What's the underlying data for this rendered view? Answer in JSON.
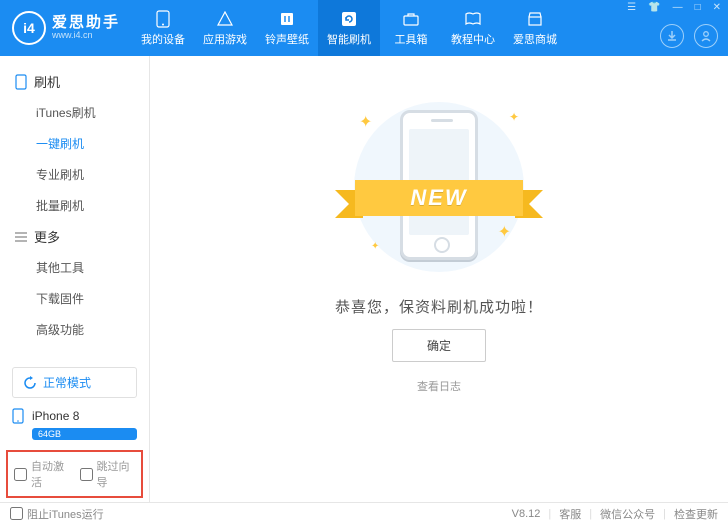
{
  "brand": {
    "title": "爱思助手",
    "subtitle": "www.i4.cn",
    "logo_text": "i4"
  },
  "tabs": {
    "device": "我的设备",
    "apps": "应用游戏",
    "ringtone": "铃声壁纸",
    "flash": "智能刷机",
    "toolbox": "工具箱",
    "tutorial": "教程中心",
    "mall": "爱思商城"
  },
  "sidebar": {
    "flash_title": "刷机",
    "flash_items": {
      "itunes": "iTunes刷机",
      "oneclick": "一键刷机",
      "pro": "专业刷机",
      "batch": "批量刷机"
    },
    "more_title": "更多",
    "more_items": {
      "other_tools": "其他工具",
      "download_fw": "下载固件",
      "advanced": "高级功能"
    },
    "mode": "正常模式",
    "device_name": "iPhone 8",
    "device_cap": "64GB"
  },
  "options": {
    "auto_activate": "自动激活",
    "skip_guide": "跳过向导"
  },
  "main": {
    "ribbon": "NEW",
    "success": "恭喜您，保资料刷机成功啦！",
    "confirm": "确定",
    "view_log": "查看日志"
  },
  "footer": {
    "block_itunes": "阻止iTunes运行",
    "version": "V8.12",
    "support": "客服",
    "wechat": "微信公众号",
    "check_update": "检查更新"
  }
}
